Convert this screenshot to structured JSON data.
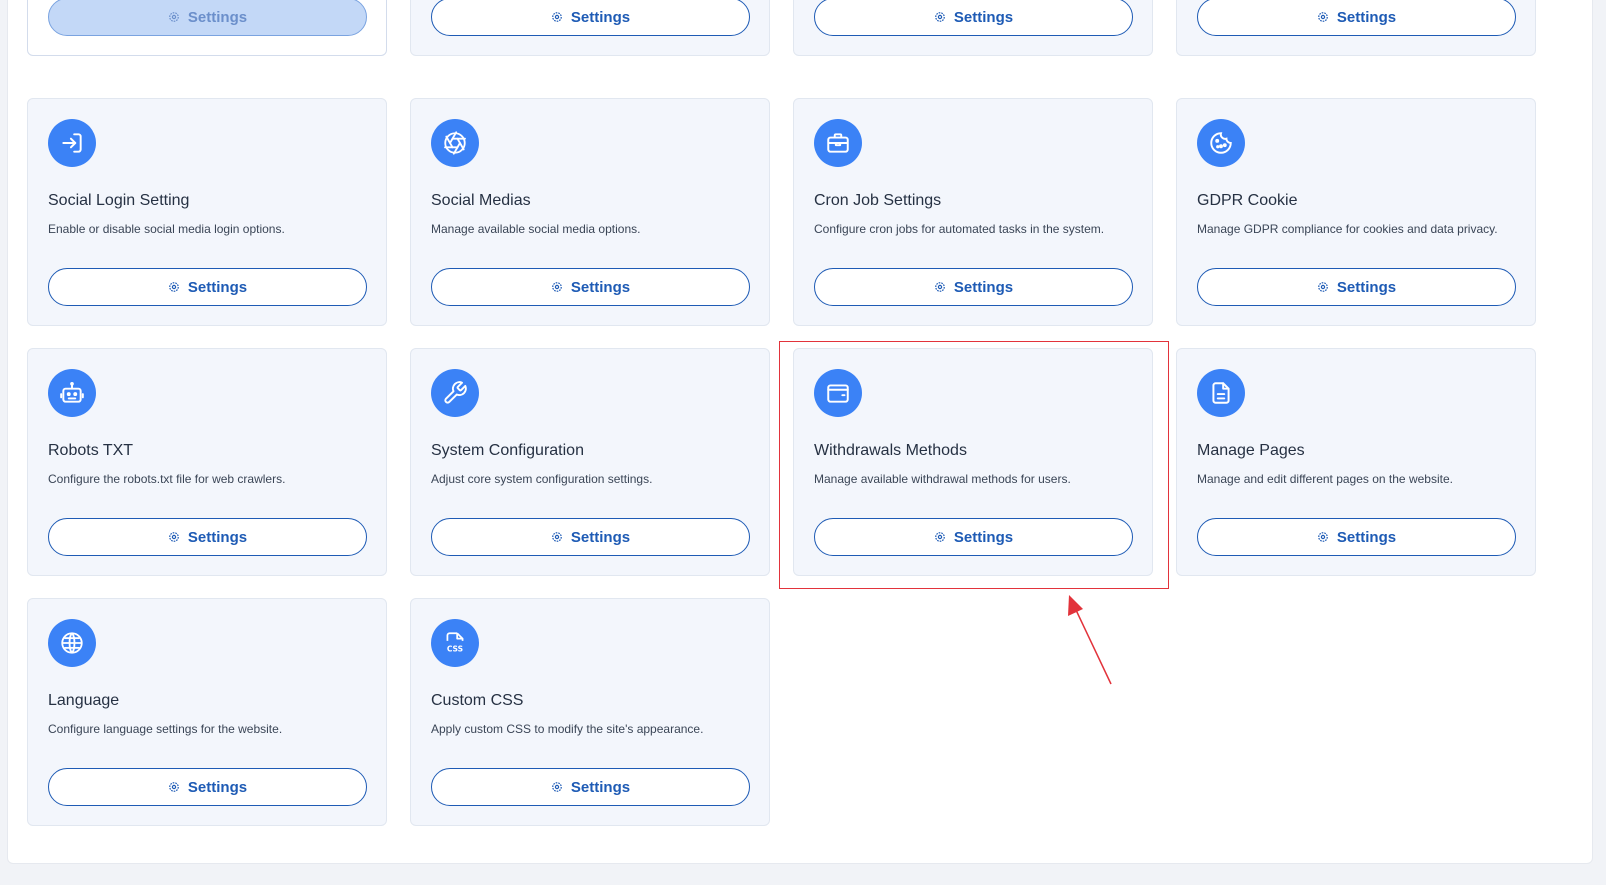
{
  "settings_label": "Settings",
  "accent_color": "#3b82f6",
  "button_color": "#1e5bb5",
  "annotation_color": "#e2333b",
  "top_row": [
    {
      "state": "disabled"
    },
    {
      "state": "normal"
    },
    {
      "state": "normal"
    },
    {
      "state": "normal"
    }
  ],
  "cards": [
    {
      "title": "Social Login Setting",
      "desc": "Enable or disable social media login options.",
      "icon": "login-arrow-icon"
    },
    {
      "title": "Social Medias",
      "desc": "Manage available social media options.",
      "icon": "aperture-icon"
    },
    {
      "title": "Cron Job Settings",
      "desc": "Configure cron jobs for automated tasks in the system.",
      "icon": "briefcase-icon"
    },
    {
      "title": "GDPR Cookie",
      "desc": "Manage GDPR compliance for cookies and data privacy.",
      "icon": "cookie-icon"
    },
    {
      "title": "Robots TXT",
      "desc": "Configure the robots.txt file for web crawlers.",
      "icon": "robot-icon"
    },
    {
      "title": "System Configuration",
      "desc": "Adjust core system configuration settings.",
      "icon": "wrench-icon"
    },
    {
      "title": "Withdrawals Methods",
      "desc": "Manage available withdrawal methods for users.",
      "icon": "wallet-icon"
    },
    {
      "title": "Manage Pages",
      "desc": "Manage and edit different pages on the website.",
      "icon": "document-icon"
    },
    {
      "title": "Language",
      "desc": "Configure language settings for the website.",
      "icon": "globe-icon"
    },
    {
      "title": "Custom CSS",
      "desc": "Apply custom CSS to modify the site's appearance.",
      "icon": "css-file-icon"
    }
  ]
}
